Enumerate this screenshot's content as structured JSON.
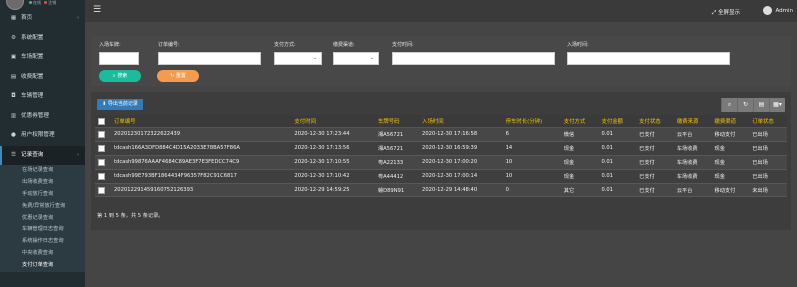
{
  "sidebar": {
    "status_dots": [
      "#2ecc71",
      "#e74c3c"
    ],
    "status_text": [
      "在线",
      "注销"
    ],
    "items": [
      {
        "label": "首页",
        "icon": "dashboard-icon",
        "glyph": "▦",
        "has_arrow": true
      },
      {
        "label": "系统配置",
        "icon": "gear-icon",
        "glyph": "⚙",
        "has_arrow": false
      },
      {
        "label": "车场配置",
        "icon": "car-icon",
        "glyph": "▣",
        "has_arrow": false
      },
      {
        "label": "收费配置",
        "icon": "money-icon",
        "glyph": "▤",
        "has_arrow": false
      },
      {
        "label": "车辆管理",
        "icon": "vehicle-icon",
        "glyph": "◘",
        "has_arrow": false
      },
      {
        "label": "优惠券管理",
        "icon": "coupon-icon",
        "glyph": "▥",
        "has_arrow": false
      },
      {
        "label": "用户权限管理",
        "icon": "user-icon",
        "glyph": "●",
        "has_arrow": false
      },
      {
        "label": "记录查询",
        "icon": "list-icon",
        "glyph": "☰",
        "has_arrow": true
      }
    ],
    "sub_items": [
      "在场记录查询",
      "出场收费查询",
      "手动放行查询",
      "免费/异常放行查询",
      "优惠记录查询",
      "车辆管理日志查询",
      "系统操作日志查询",
      "中央收费查询",
      "支付订单查询"
    ]
  },
  "topbar": {
    "fullscreen_label": "全屏显示",
    "user_name": "Admin"
  },
  "search": {
    "fields": [
      {
        "label": "入场车牌:",
        "type": "text"
      },
      {
        "label": "订单编号:",
        "type": "text"
      },
      {
        "label": "支付方式:",
        "type": "select"
      },
      {
        "label": "缴费渠道:",
        "type": "select"
      },
      {
        "label": "支付时间:",
        "type": "text"
      },
      {
        "label": "入场时间:",
        "type": "text"
      }
    ],
    "search_button": "搜索",
    "reset_button": "重置"
  },
  "table": {
    "export_button": "导出当前记录",
    "columns": [
      "订单编号",
      "支付时间",
      "车牌号码",
      "入场时间",
      "停车时长(分钟)",
      "支付方式",
      "支付金额",
      "支付状态",
      "缴费来源",
      "缴费渠道",
      "订单状态"
    ],
    "rows": [
      [
        "20201230172322622439",
        "2020-12-30 17:23:44",
        "湘A56721",
        "2020-12-30 17:16:58",
        "6",
        "微信",
        "0.01",
        "已支付",
        "云平台",
        "移动支付",
        "已出场"
      ],
      [
        "tdcash166A3DFD884C4D15A2033E78BA57F86A",
        "2020-12-30 17:13:56",
        "湘A56721",
        "2020-12-30 16:59:39",
        "14",
        "现金",
        "0.01",
        "已支付",
        "车场收费",
        "现金",
        "已出场"
      ],
      [
        "tdcash99876AAAF4684C89AE3F7E3FEDCC74C9",
        "2020-12-30 17:10:55",
        "粤A22133",
        "2020-12-30 17:00:20",
        "10",
        "现金",
        "0.01",
        "已支付",
        "车场收费",
        "现金",
        "已出场"
      ],
      [
        "tdcash99E793BF1864434F96357F82C91C6817",
        "2020-12-30 17:10:42",
        "粤A44412",
        "2020-12-30 17:00:14",
        "10",
        "现金",
        "0.01",
        "已支付",
        "车场收费",
        "现金",
        "已出场"
      ],
      [
        "202012291459160752126393",
        "2020-12-29 14:59:25",
        "赣D89N91",
        "2020-12-29 14:48:40",
        "0",
        "其它",
        "0.01",
        "已支付",
        "云平台",
        "移动支付",
        "未出场"
      ]
    ],
    "pagination": "第 1 到 5 条，共 5 条记录。"
  }
}
